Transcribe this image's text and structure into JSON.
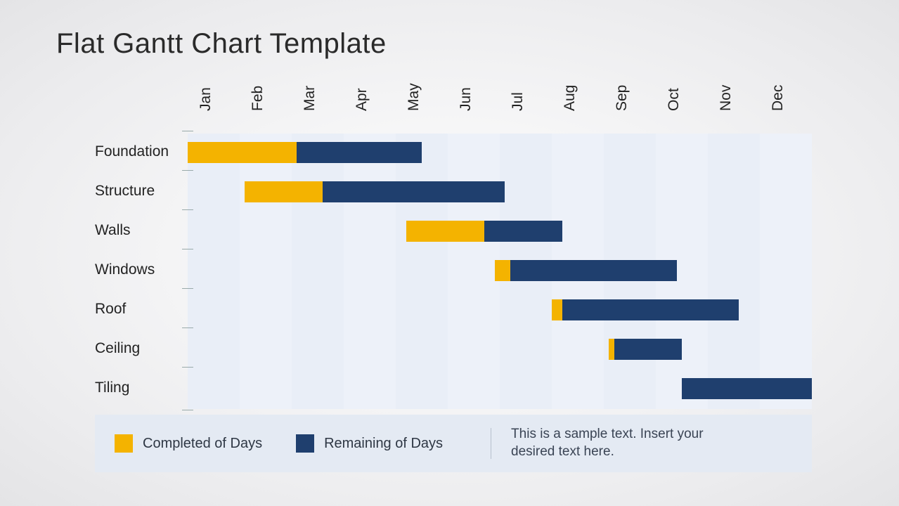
{
  "title": "Flat Gantt Chart Template",
  "months": [
    "Jan",
    "Feb",
    "Mar",
    "Apr",
    "May",
    "Jun",
    "Jul",
    "Aug",
    "Sep",
    "Oct",
    "Nov",
    "Dec"
  ],
  "legend": {
    "completed": "Completed of Days",
    "remaining": "Remaining of Days"
  },
  "footer_text": "This is a sample text. Insert your desired text here.",
  "colors": {
    "completed": "#f4b300",
    "remaining": "#1f3f6e",
    "panel": "#e4eaf3",
    "stripe_light": "#e9eef7",
    "stripe_lighter": "#edf1f9"
  },
  "chart_data": {
    "type": "bar",
    "orientation": "horizontal",
    "title": "Flat Gantt Chart Template",
    "xlabel": "",
    "ylabel": "",
    "categories": [
      "Jan",
      "Feb",
      "Mar",
      "Apr",
      "May",
      "Jun",
      "Jul",
      "Aug",
      "Sep",
      "Oct",
      "Nov",
      "Dec"
    ],
    "tasks": [
      {
        "name": "Foundation",
        "start": 0.0,
        "completed": 2.1,
        "remaining": 2.4
      },
      {
        "name": "Structure",
        "start": 1.1,
        "completed": 1.5,
        "remaining": 3.5
      },
      {
        "name": "Walls",
        "start": 4.2,
        "completed": 1.5,
        "remaining": 1.5
      },
      {
        "name": "Windows",
        "start": 5.9,
        "completed": 0.3,
        "remaining": 3.2
      },
      {
        "name": "Roof",
        "start": 7.0,
        "completed": 0.2,
        "remaining": 3.4
      },
      {
        "name": "Ceiling",
        "start": 8.1,
        "completed": 0.1,
        "remaining": 1.3
      },
      {
        "name": "Tiling",
        "start": 9.5,
        "completed": 0.0,
        "remaining": 2.5
      }
    ],
    "xlim": [
      0,
      12
    ],
    "legend": [
      "Completed of Days",
      "Remaining of Days"
    ]
  }
}
